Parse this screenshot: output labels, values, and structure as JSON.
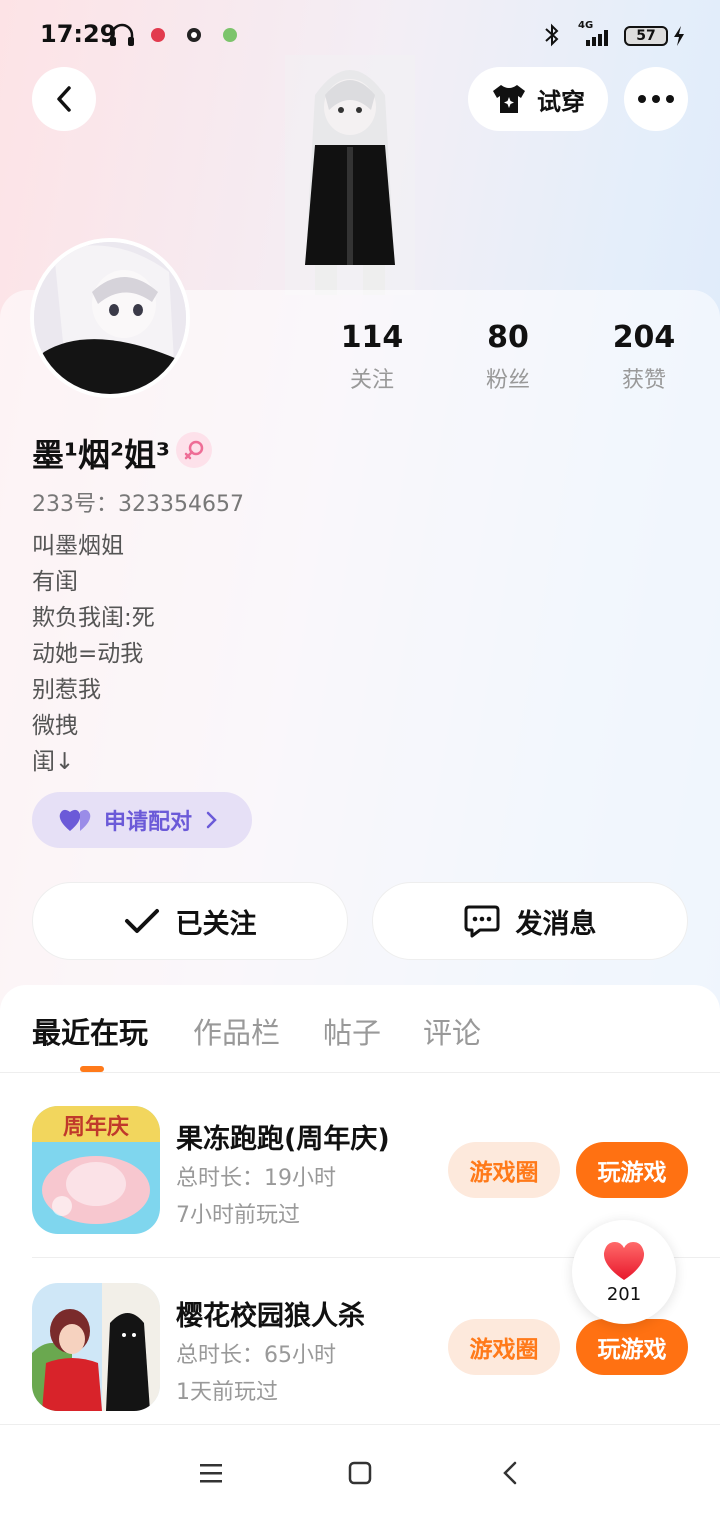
{
  "status_bar": {
    "time": "17:29",
    "network": "4G",
    "battery": "57"
  },
  "header": {
    "tryon_label": "试穿"
  },
  "profile": {
    "nickname": "墨¹烟²姐³",
    "user_id": "233号：323354657",
    "bio": [
      "叫墨烟姐",
      "有闺",
      "欺负我闺:死",
      "动她=动我",
      "别惹我",
      "微拽",
      "闺↓"
    ],
    "stats": [
      {
        "value": "114",
        "label": "关注"
      },
      {
        "value": "80",
        "label": "粉丝"
      },
      {
        "value": "204",
        "label": "获赞"
      }
    ],
    "pair_label": "申请配对",
    "follow_label": "已关注",
    "message_label": "发消息"
  },
  "tabs": [
    "最近在玩",
    "作品栏",
    "帖子",
    "评论"
  ],
  "games": [
    {
      "title": "果冻跑跑(周年庆)",
      "duration": "总时长：19小时",
      "last_played": "7小时前玩过",
      "icon_text": "周年庆",
      "circle_label": "游戏圈",
      "play_label": "玩游戏"
    },
    {
      "title": "樱花校园狼人杀",
      "duration": "总时长：65小时",
      "last_played": "1天前玩过",
      "circle_label": "游戏圈",
      "play_label": "玩游戏"
    }
  ],
  "like_float": {
    "count": "201"
  },
  "colors": {
    "accent": "#ff7112",
    "pair_purple": "#6b5ad8"
  }
}
